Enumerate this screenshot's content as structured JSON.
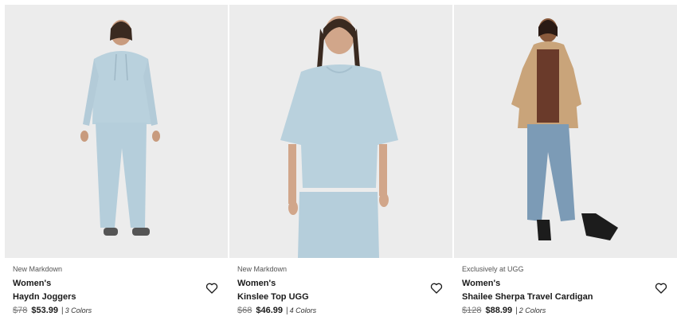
{
  "products": [
    {
      "badge": "New Markdown",
      "category": "Women's",
      "name": "Haydn Joggers",
      "old_price": "$78",
      "price": "$53.99",
      "separator": "|",
      "colors": "3 Colors",
      "icons": {
        "wishlist": "heart-icon"
      }
    },
    {
      "badge": "New Markdown",
      "category": "Women's",
      "name": "Kinslee Top UGG",
      "old_price": "$68",
      "price": "$46.99",
      "separator": "|",
      "colors": "4 Colors",
      "icons": {
        "wishlist": "heart-icon"
      }
    },
    {
      "badge": "Exclusively at UGG",
      "category": "Women's",
      "name": "Shailee Sherpa Travel Cardigan",
      "old_price": "$128",
      "price": "$88.99",
      "separator": "|",
      "colors": "2 Colors",
      "icons": {
        "wishlist": "heart-icon"
      }
    }
  ],
  "colors": {
    "image_bg": "#ececec",
    "pale_blue": "#b9d1dd",
    "tan_sherpa": "#c9a47a",
    "denim": "#7c9bb6",
    "text": "#1a1a1a"
  }
}
